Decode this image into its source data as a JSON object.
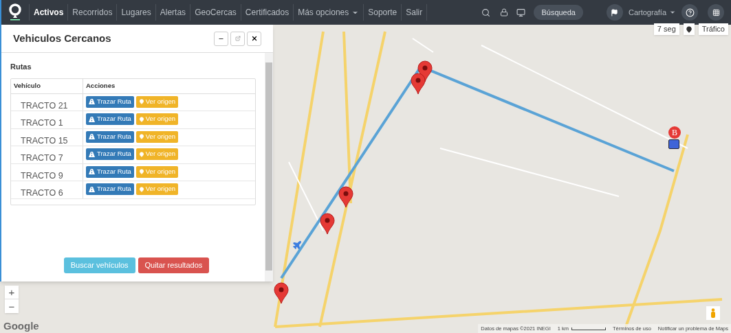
{
  "navbar": {
    "items": [
      {
        "label": "Activos",
        "selected": true,
        "kind": "link"
      },
      {
        "label": "Recorridos",
        "selected": false,
        "kind": "link"
      },
      {
        "label": "Lugares",
        "selected": false,
        "kind": "link"
      },
      {
        "label": "Alertas",
        "selected": false,
        "kind": "link"
      },
      {
        "label": "GeoCercas",
        "selected": false,
        "kind": "link"
      },
      {
        "label": "Certificados",
        "selected": false,
        "kind": "link"
      },
      {
        "label": "Más opciones",
        "selected": false,
        "kind": "dropdown"
      },
      {
        "label": "Soporte",
        "selected": false,
        "kind": "link"
      },
      {
        "label": "Salir",
        "selected": false,
        "kind": "link"
      }
    ],
    "search_button": "Búsqueda",
    "map_menu": "Cartografía"
  },
  "map": {
    "refresh": "7 seg",
    "traffic": "Tráfico",
    "zoom_in": "+",
    "zoom_out": "−",
    "logo": "Google",
    "destination_marker": "B",
    "attribution": [
      "Datos de mapas ©2021 INEGI",
      "1 km",
      "Términos de uso",
      "Notificar un problema de Maps"
    ]
  },
  "panel": {
    "title": "Vehiculos Cercanos",
    "section": "Rutas",
    "columns": [
      "Vehículo",
      "Acciones"
    ],
    "rows": [
      {
        "vehicle": "TRACTO 21",
        "route": "Trazar Ruta",
        "origin": "Ver origen"
      },
      {
        "vehicle": "TRACTO 1",
        "route": "Trazar Ruta",
        "origin": "Ver origen"
      },
      {
        "vehicle": "TRACTO 15",
        "route": "Trazar Ruta",
        "origin": "Ver origen"
      },
      {
        "vehicle": "TRACTO 7",
        "route": "Trazar Ruta",
        "origin": "Ver origen"
      },
      {
        "vehicle": "TRACTO 9",
        "route": "Trazar Ruta",
        "origin": "Ver origen"
      },
      {
        "vehicle": "TRACTO 6",
        "route": "Trazar Ruta",
        "origin": "Ver origen"
      }
    ],
    "buttons": [
      {
        "label": "Buscar vehículos",
        "kind": "info"
      },
      {
        "label": "Quitar resultados",
        "kind": "danger"
      }
    ]
  }
}
